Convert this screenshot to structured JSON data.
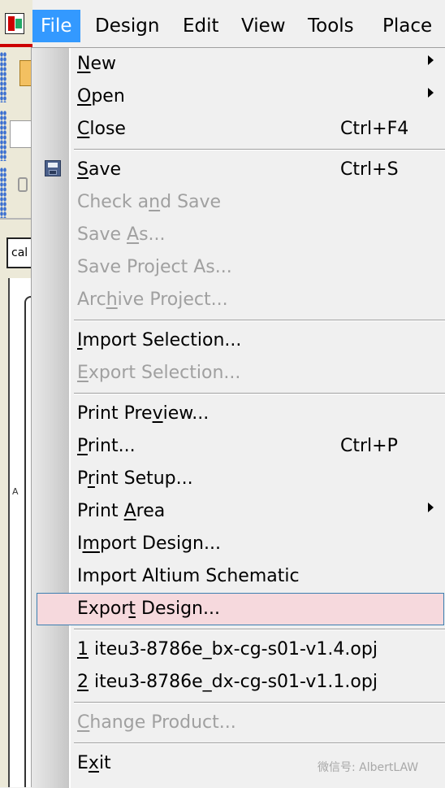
{
  "menubar": {
    "items": [
      "File",
      "Design",
      "Edit",
      "View",
      "Tools",
      "Place"
    ]
  },
  "doc_tab_label": "cal",
  "canvas_label": "A",
  "file_menu": {
    "new": {
      "prefix": "",
      "accel": "N",
      "suffix": "ew"
    },
    "open": {
      "prefix": "",
      "accel": "O",
      "suffix": "pen"
    },
    "close": {
      "prefix": "",
      "accel": "C",
      "suffix": "lose",
      "shortcut": "Ctrl+F4"
    },
    "save": {
      "prefix": "",
      "accel": "S",
      "suffix": "ave",
      "shortcut": "Ctrl+S"
    },
    "check_and_save": {
      "prefix": "Check a",
      "accel": "n",
      "suffix": "d Save"
    },
    "save_as": {
      "prefix": "Save ",
      "accel": "A",
      "suffix": "s..."
    },
    "save_project_as": {
      "prefix": "Save Project As...",
      "accel": "",
      "suffix": ""
    },
    "archive_project": {
      "prefix": "Arc",
      "accel": "h",
      "suffix": "ive Project..."
    },
    "import_selection": {
      "prefix": "",
      "accel": "I",
      "suffix": "mport Selection..."
    },
    "export_selection": {
      "prefix": "",
      "accel": "E",
      "suffix": "xport Selection..."
    },
    "print_preview": {
      "prefix": "Print Pre",
      "accel": "v",
      "suffix": "iew..."
    },
    "print": {
      "prefix": "",
      "accel": "P",
      "suffix": "rint...",
      "shortcut": "Ctrl+P"
    },
    "print_setup": {
      "prefix": "P",
      "accel": "r",
      "suffix": "int Setup..."
    },
    "print_area": {
      "prefix": "Print ",
      "accel": "A",
      "suffix": "rea"
    },
    "import_design": {
      "prefix": "I",
      "accel": "m",
      "suffix": "port Design..."
    },
    "import_altium": {
      "prefix": "Import Altium Schematic",
      "accel": "",
      "suffix": ""
    },
    "export_design": {
      "prefix": "Expor",
      "accel": "t",
      "suffix": " Design..."
    },
    "recent_1": {
      "prefix": "",
      "accel": "1",
      "suffix": " iteu3-8786e_bx-cg-s01-v1.4.opj"
    },
    "recent_2": {
      "prefix": "",
      "accel": "2",
      "suffix": " iteu3-8786e_dx-cg-s01-v1.1.opj"
    },
    "change_product": {
      "prefix": "",
      "accel": "C",
      "suffix": "hange Product..."
    },
    "exit": {
      "prefix": "E",
      "accel": "x",
      "suffix": "it"
    }
  },
  "watermark": "微信号: AlbertLAW",
  "colors": {
    "menu_active_bg": "#3399ff",
    "hover_bg": "#f6d9dd",
    "hover_border": "#3c7fb1",
    "disabled_text": "#a0a0a0"
  },
  "icons": [
    "app-icon",
    "save-icon",
    "submenu-arrow-icon"
  ]
}
